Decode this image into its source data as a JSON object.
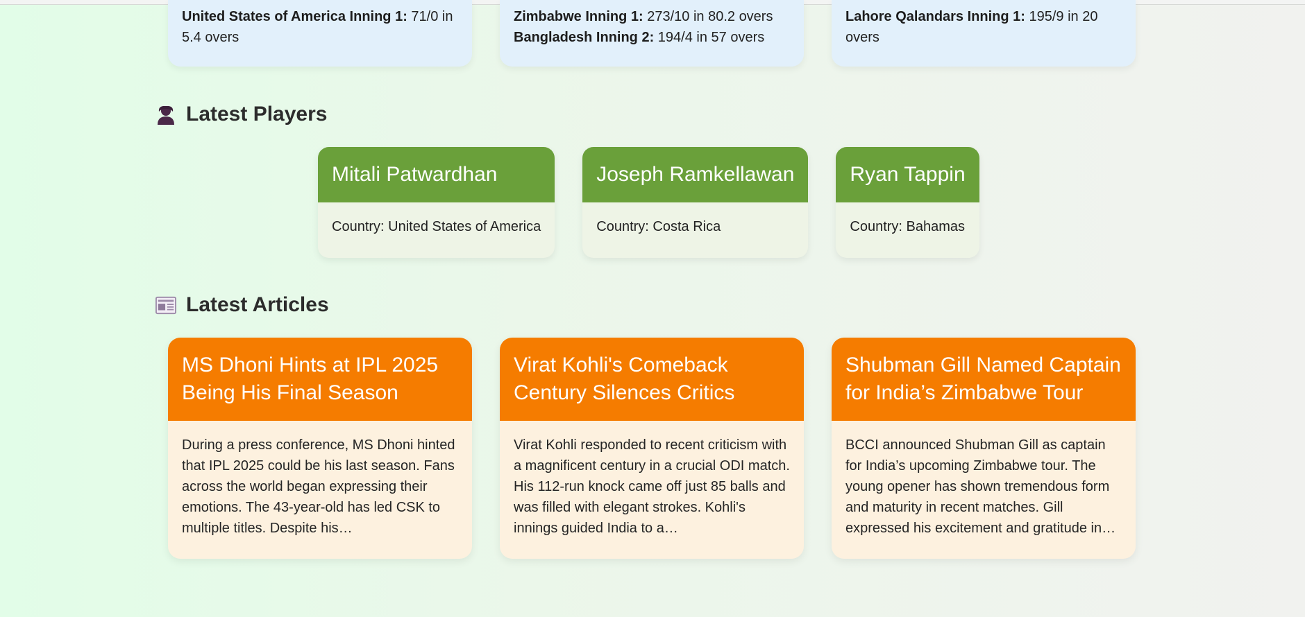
{
  "matches": [
    {
      "lines": [
        {
          "team": "United States of America Inning 1:",
          "score": " 71/0 in 5.4 overs"
        }
      ]
    },
    {
      "lines": [
        {
          "team": "Zimbabwe Inning 1:",
          "score": " 273/10 in 80.2 overs"
        },
        {
          "team": "Bangladesh Inning 2:",
          "score": " 194/4 in 57 overs"
        }
      ]
    },
    {
      "lines": [
        {
          "team": "Lahore Qalandars Inning 1:",
          "score": " 195/9 in 20 overs"
        }
      ]
    }
  ],
  "players_section": {
    "title": "Latest Players",
    "icon": "person-icon",
    "players": [
      {
        "name": "Mitali Patwardhan",
        "country": "Country: United States of America"
      },
      {
        "name": "Joseph Ramkellawan",
        "country": "Country: Costa Rica"
      },
      {
        "name": "Ryan Tappin",
        "country": "Country: Bahamas"
      }
    ]
  },
  "articles_section": {
    "title": "Latest Articles",
    "icon": "newspaper-icon",
    "articles": [
      {
        "title": "MS Dhoni Hints at IPL 2025 Being His Final Season",
        "excerpt": "During a press conference, MS Dhoni hinted that IPL 2025 could be his last season. Fans across the world began expressing their emotions. The 43-year-old has led CSK to multiple titles. Despite his…"
      },
      {
        "title": "Virat Kohli's Comeback Century Silences Critics",
        "excerpt": "Virat Kohli responded to recent criticism with a magnificent century in a crucial ODI match. His 112-run knock came off just 85 balls and was filled with elegant strokes. Kohli's innings guided India to a…"
      },
      {
        "title": "Shubman Gill Named Captain for India’s Zimbabwe Tour",
        "excerpt": "BCCI announced Shubman Gill as captain for India’s upcoming Zimbabwe tour. The young opener has shown tremendous form and maturity in recent matches. Gill expressed his excitement and gratitude in…"
      }
    ]
  },
  "colors": {
    "player_header": "#6aa03a",
    "article_header": "#f57c00",
    "match_card_bg": "#e2f0fb"
  }
}
